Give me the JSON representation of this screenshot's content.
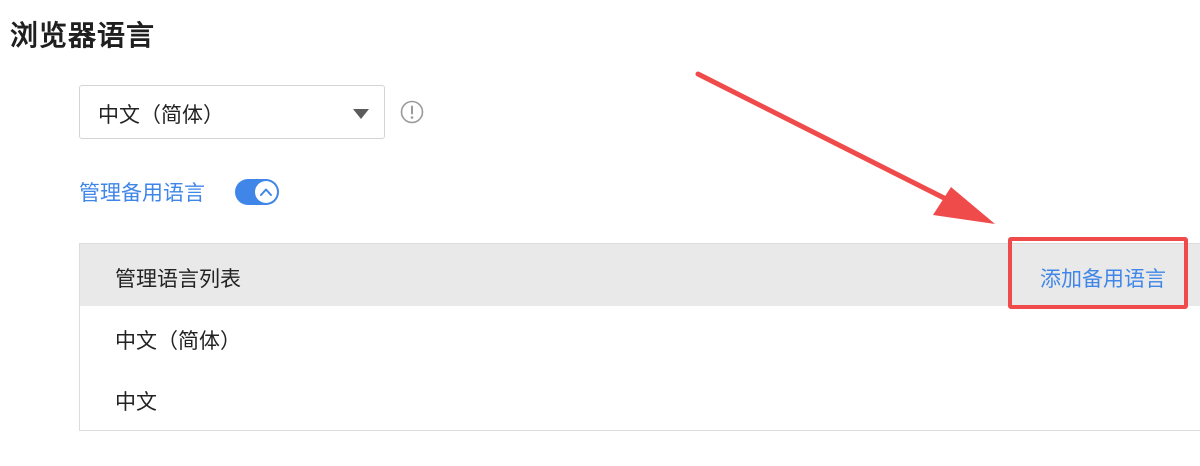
{
  "section": {
    "title": "浏览器语言"
  },
  "language_select": {
    "selected": "中文（简体）"
  },
  "manage_backup": {
    "label": "管理备用语言",
    "toggle_on": true
  },
  "language_list": {
    "header": "管理语言列表",
    "add_button": "添加备用语言",
    "items": [
      "中文（简体）",
      "中文"
    ]
  },
  "colors": {
    "accent": "#3f86e8",
    "annotation": "#ef4b4b"
  }
}
